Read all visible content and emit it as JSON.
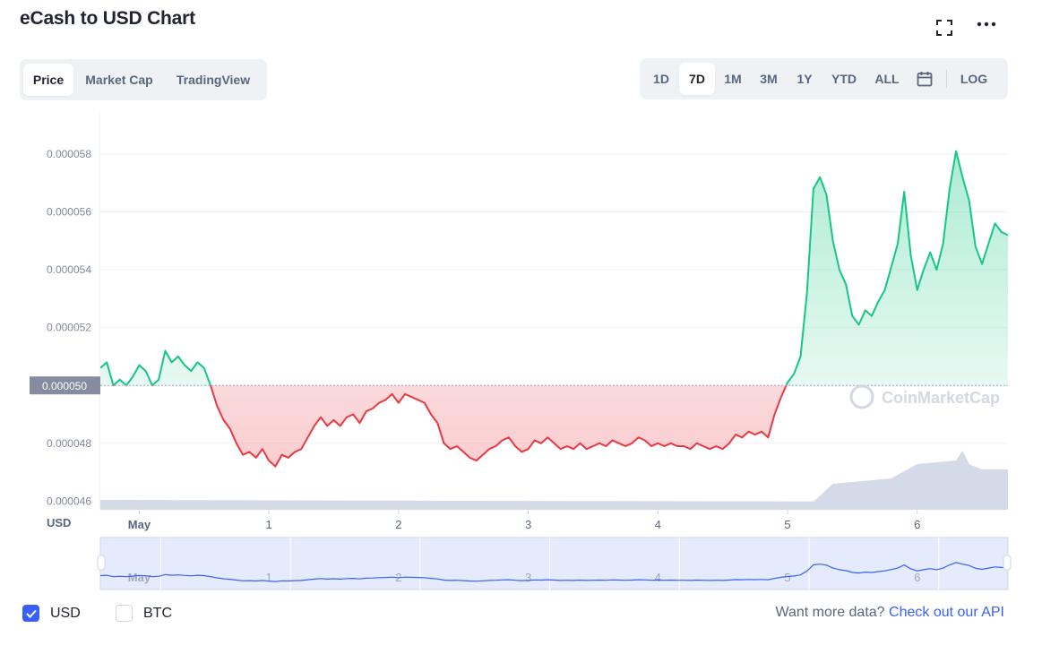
{
  "header": {
    "title": "eCash to USD Chart"
  },
  "view_tabs": [
    "Price",
    "Market Cap",
    "TradingView"
  ],
  "view_active": "Price",
  "range_tabs": [
    "1D",
    "7D",
    "1M",
    "3M",
    "1Y",
    "YTD",
    "ALL"
  ],
  "range_active": "7D",
  "log_label": "LOG",
  "legend": {
    "usd_label": "USD",
    "btc_label": "BTC",
    "usd_checked": true,
    "btc_checked": false
  },
  "footer": {
    "prompt": "Want more data?",
    "link_text": "Check out our API"
  },
  "watermark": "CoinMarketCap",
  "colors": {
    "up": "#16c784",
    "down": "#ea3943",
    "accent": "#3861fb",
    "volume": "#cfd6e4"
  },
  "chart_data": {
    "type": "line",
    "y_axis_unit_label": "USD",
    "ylim": [
      4.57e-05,
      5.93e-05
    ],
    "y_ticks": [
      "0.000046",
      "0.000048",
      "0.000050",
      "0.000052",
      "0.000054",
      "0.000056",
      "0.000058"
    ],
    "y_tick_values": [
      4.6e-05,
      4.8e-05,
      5e-05,
      5.2e-05,
      5.4e-05,
      5.6e-05,
      5.8e-05
    ],
    "baseline_value": 5e-05,
    "baseline_label": "0.000050",
    "x_range": [
      -0.3,
      6.7
    ],
    "x_ticks": [
      "May",
      "1",
      "2",
      "3",
      "4",
      "5",
      "6"
    ],
    "x_tick_values": [
      0,
      1,
      2,
      3,
      4,
      5,
      6
    ],
    "grid": true,
    "series": [
      {
        "x": [
          -0.3,
          -0.25,
          -0.2,
          -0.15,
          -0.1,
          -0.05,
          0,
          0.05,
          0.1,
          0.15,
          0.2,
          0.25,
          0.3,
          0.35,
          0.4,
          0.45,
          0.5,
          0.55,
          0.6,
          0.65,
          0.7,
          0.75,
          0.8,
          0.85,
          0.9,
          0.95,
          1,
          1.05,
          1.1,
          1.15,
          1.2,
          1.25,
          1.3,
          1.35,
          1.4,
          1.45,
          1.5,
          1.55,
          1.6,
          1.65,
          1.7,
          1.75,
          1.8,
          1.85,
          1.9,
          1.95,
          2,
          2.05,
          2.1,
          2.15,
          2.2,
          2.25,
          2.3,
          2.35,
          2.4,
          2.45,
          2.5,
          2.55,
          2.6,
          2.65,
          2.7,
          2.75,
          2.8,
          2.85,
          2.9,
          2.95,
          3,
          3.05,
          3.1,
          3.15,
          3.2,
          3.25,
          3.3,
          3.35,
          3.4,
          3.45,
          3.5,
          3.55,
          3.6,
          3.65,
          3.7,
          3.75,
          3.8,
          3.85,
          3.9,
          3.95,
          4,
          4.05,
          4.1,
          4.15,
          4.2,
          4.25,
          4.3,
          4.35,
          4.4,
          4.45,
          4.5,
          4.55,
          4.6,
          4.65,
          4.7,
          4.75,
          4.8,
          4.85,
          4.9,
          4.95,
          5,
          5.05,
          5.1,
          5.15,
          5.2,
          5.25,
          5.3,
          5.35,
          5.4,
          5.45,
          5.5,
          5.55,
          5.6,
          5.65,
          5.7,
          5.75,
          5.8,
          5.85,
          5.9,
          5.95,
          6,
          6.05,
          6.1,
          6.15,
          6.2,
          6.25,
          6.3,
          6.35,
          6.4,
          6.45,
          6.5,
          6.55,
          6.6,
          6.65,
          6.7
        ],
        "values": [
          5.06e-05,
          5.08e-05,
          5e-05,
          5.02e-05,
          5e-05,
          5.03e-05,
          5.07e-05,
          5.05e-05,
          5e-05,
          5.02e-05,
          5.12e-05,
          5.08e-05,
          5.1e-05,
          5.07e-05,
          5.05e-05,
          5.08e-05,
          5.06e-05,
          5e-05,
          4.93e-05,
          4.88e-05,
          4.85e-05,
          4.8e-05,
          4.76e-05,
          4.77e-05,
          4.75e-05,
          4.78e-05,
          4.74e-05,
          4.72e-05,
          4.76e-05,
          4.75e-05,
          4.77e-05,
          4.78e-05,
          4.82e-05,
          4.86e-05,
          4.89e-05,
          4.86e-05,
          4.88e-05,
          4.86e-05,
          4.89e-05,
          4.9e-05,
          4.87e-05,
          4.91e-05,
          4.92e-05,
          4.94e-05,
          4.95e-05,
          4.97e-05,
          4.94e-05,
          4.97e-05,
          4.96e-05,
          4.95e-05,
          4.94e-05,
          4.9e-05,
          4.87e-05,
          4.8e-05,
          4.78e-05,
          4.79e-05,
          4.77e-05,
          4.75e-05,
          4.74e-05,
          4.76e-05,
          4.78e-05,
          4.79e-05,
          4.81e-05,
          4.82e-05,
          4.79e-05,
          4.77e-05,
          4.78e-05,
          4.81e-05,
          4.8e-05,
          4.82e-05,
          4.8e-05,
          4.78e-05,
          4.79e-05,
          4.78e-05,
          4.8e-05,
          4.78e-05,
          4.79e-05,
          4.8e-05,
          4.79e-05,
          4.81e-05,
          4.8e-05,
          4.79e-05,
          4.8e-05,
          4.82e-05,
          4.81e-05,
          4.79e-05,
          4.8e-05,
          4.79e-05,
          4.8e-05,
          4.79e-05,
          4.79e-05,
          4.78e-05,
          4.8e-05,
          4.79e-05,
          4.78e-05,
          4.79e-05,
          4.78e-05,
          4.8e-05,
          4.83e-05,
          4.82e-05,
          4.84e-05,
          4.83e-05,
          4.84e-05,
          4.82e-05,
          4.9e-05,
          4.96e-05,
          5.01e-05,
          5.04e-05,
          5.1e-05,
          5.32e-05,
          5.68e-05,
          5.72e-05,
          5.66e-05,
          5.5e-05,
          5.4e-05,
          5.35e-05,
          5.24e-05,
          5.21e-05,
          5.26e-05,
          5.24e-05,
          5.29e-05,
          5.33e-05,
          5.41e-05,
          5.49e-05,
          5.67e-05,
          5.45e-05,
          5.33e-05,
          5.4e-05,
          5.46e-05,
          5.4e-05,
          5.49e-05,
          5.68e-05,
          5.81e-05,
          5.72e-05,
          5.64e-05,
          5.48e-05,
          5.42e-05,
          5.49e-05,
          5.56e-05,
          5.53e-05,
          5.52e-05
        ]
      }
    ]
  }
}
